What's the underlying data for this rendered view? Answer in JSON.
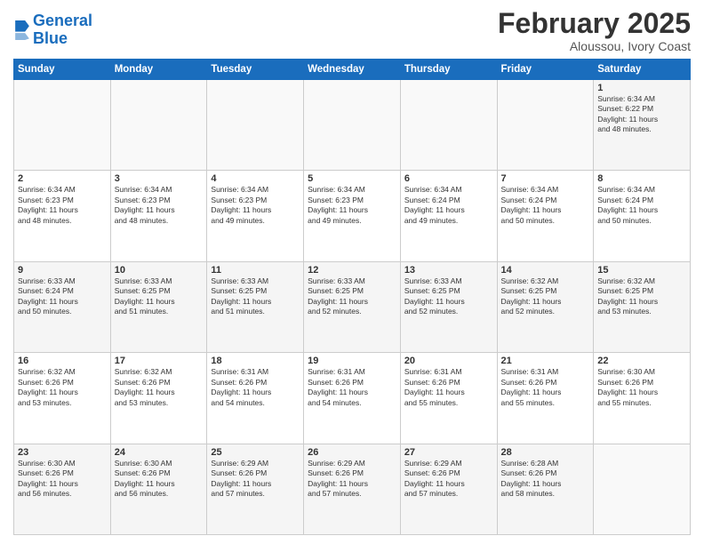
{
  "header": {
    "logo_line1": "General",
    "logo_line2": "Blue",
    "month": "February 2025",
    "location": "Aloussou, Ivory Coast"
  },
  "days_of_week": [
    "Sunday",
    "Monday",
    "Tuesday",
    "Wednesday",
    "Thursday",
    "Friday",
    "Saturday"
  ],
  "weeks": [
    [
      {
        "day": "",
        "info": ""
      },
      {
        "day": "",
        "info": ""
      },
      {
        "day": "",
        "info": ""
      },
      {
        "day": "",
        "info": ""
      },
      {
        "day": "",
        "info": ""
      },
      {
        "day": "",
        "info": ""
      },
      {
        "day": "1",
        "info": "Sunrise: 6:34 AM\nSunset: 6:22 PM\nDaylight: 11 hours\nand 48 minutes."
      }
    ],
    [
      {
        "day": "2",
        "info": "Sunrise: 6:34 AM\nSunset: 6:23 PM\nDaylight: 11 hours\nand 48 minutes."
      },
      {
        "day": "3",
        "info": "Sunrise: 6:34 AM\nSunset: 6:23 PM\nDaylight: 11 hours\nand 48 minutes."
      },
      {
        "day": "4",
        "info": "Sunrise: 6:34 AM\nSunset: 6:23 PM\nDaylight: 11 hours\nand 49 minutes."
      },
      {
        "day": "5",
        "info": "Sunrise: 6:34 AM\nSunset: 6:23 PM\nDaylight: 11 hours\nand 49 minutes."
      },
      {
        "day": "6",
        "info": "Sunrise: 6:34 AM\nSunset: 6:24 PM\nDaylight: 11 hours\nand 49 minutes."
      },
      {
        "day": "7",
        "info": "Sunrise: 6:34 AM\nSunset: 6:24 PM\nDaylight: 11 hours\nand 50 minutes."
      },
      {
        "day": "8",
        "info": "Sunrise: 6:34 AM\nSunset: 6:24 PM\nDaylight: 11 hours\nand 50 minutes."
      }
    ],
    [
      {
        "day": "9",
        "info": "Sunrise: 6:33 AM\nSunset: 6:24 PM\nDaylight: 11 hours\nand 50 minutes."
      },
      {
        "day": "10",
        "info": "Sunrise: 6:33 AM\nSunset: 6:25 PM\nDaylight: 11 hours\nand 51 minutes."
      },
      {
        "day": "11",
        "info": "Sunrise: 6:33 AM\nSunset: 6:25 PM\nDaylight: 11 hours\nand 51 minutes."
      },
      {
        "day": "12",
        "info": "Sunrise: 6:33 AM\nSunset: 6:25 PM\nDaylight: 11 hours\nand 52 minutes."
      },
      {
        "day": "13",
        "info": "Sunrise: 6:33 AM\nSunset: 6:25 PM\nDaylight: 11 hours\nand 52 minutes."
      },
      {
        "day": "14",
        "info": "Sunrise: 6:32 AM\nSunset: 6:25 PM\nDaylight: 11 hours\nand 52 minutes."
      },
      {
        "day": "15",
        "info": "Sunrise: 6:32 AM\nSunset: 6:25 PM\nDaylight: 11 hours\nand 53 minutes."
      }
    ],
    [
      {
        "day": "16",
        "info": "Sunrise: 6:32 AM\nSunset: 6:26 PM\nDaylight: 11 hours\nand 53 minutes."
      },
      {
        "day": "17",
        "info": "Sunrise: 6:32 AM\nSunset: 6:26 PM\nDaylight: 11 hours\nand 53 minutes."
      },
      {
        "day": "18",
        "info": "Sunrise: 6:31 AM\nSunset: 6:26 PM\nDaylight: 11 hours\nand 54 minutes."
      },
      {
        "day": "19",
        "info": "Sunrise: 6:31 AM\nSunset: 6:26 PM\nDaylight: 11 hours\nand 54 minutes."
      },
      {
        "day": "20",
        "info": "Sunrise: 6:31 AM\nSunset: 6:26 PM\nDaylight: 11 hours\nand 55 minutes."
      },
      {
        "day": "21",
        "info": "Sunrise: 6:31 AM\nSunset: 6:26 PM\nDaylight: 11 hours\nand 55 minutes."
      },
      {
        "day": "22",
        "info": "Sunrise: 6:30 AM\nSunset: 6:26 PM\nDaylight: 11 hours\nand 55 minutes."
      }
    ],
    [
      {
        "day": "23",
        "info": "Sunrise: 6:30 AM\nSunset: 6:26 PM\nDaylight: 11 hours\nand 56 minutes."
      },
      {
        "day": "24",
        "info": "Sunrise: 6:30 AM\nSunset: 6:26 PM\nDaylight: 11 hours\nand 56 minutes."
      },
      {
        "day": "25",
        "info": "Sunrise: 6:29 AM\nSunset: 6:26 PM\nDaylight: 11 hours\nand 57 minutes."
      },
      {
        "day": "26",
        "info": "Sunrise: 6:29 AM\nSunset: 6:26 PM\nDaylight: 11 hours\nand 57 minutes."
      },
      {
        "day": "27",
        "info": "Sunrise: 6:29 AM\nSunset: 6:26 PM\nDaylight: 11 hours\nand 57 minutes."
      },
      {
        "day": "28",
        "info": "Sunrise: 6:28 AM\nSunset: 6:26 PM\nDaylight: 11 hours\nand 58 minutes."
      },
      {
        "day": "",
        "info": ""
      }
    ]
  ]
}
